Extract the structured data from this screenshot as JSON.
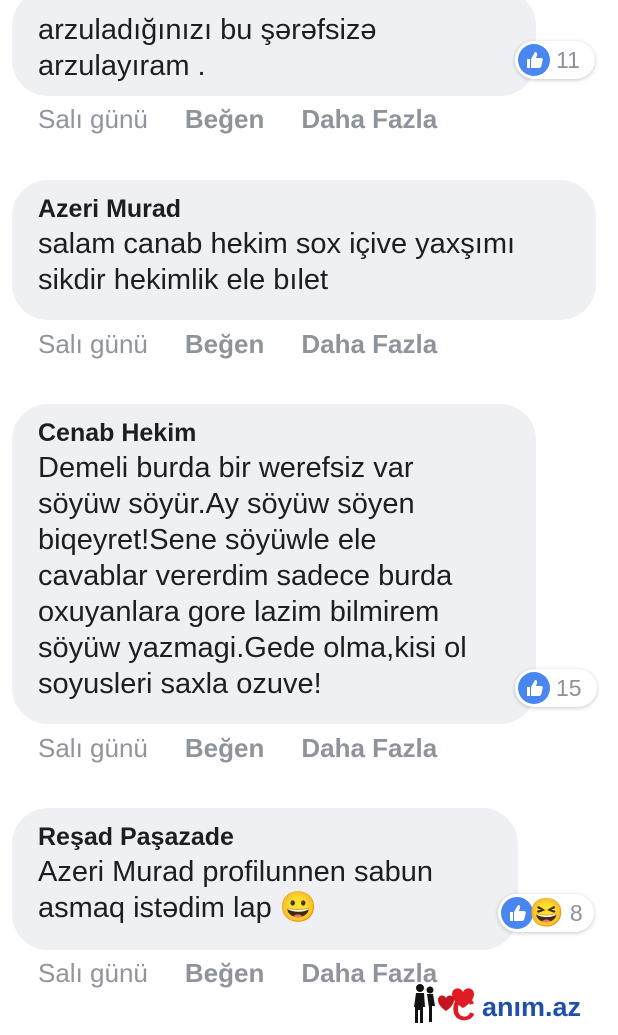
{
  "comments": [
    {
      "author": "",
      "text": "arzuladığınızı bu şərəfsizə\narzulayıram .",
      "time": "Salı günü",
      "like": "Beğen",
      "more": "Daha Fazla",
      "reaction_count": "11"
    },
    {
      "author": "Azeri Murad",
      "text": "salam canab hekim sox içive yaxşımı\nsikdir hekimlik ele bılet",
      "time": "Salı günü",
      "like": "Beğen",
      "more": "Daha Fazla",
      "reaction_count": ""
    },
    {
      "author": "Cenab Hekim",
      "text": "Demeli burda bir werefsiz var\nsöyüw söyür.Ay söyüw söyen\nbiqeyret!Sene söyüwle ele\ncavablar vererdim sadece burda\noxuyanlara gore lazim bilmirem\nsöyüw yazmagi.Gede olma,kisi ol\nsoyusleri saxla ozuve!",
      "time": "Salı günü",
      "like": "Beğen",
      "more": "Daha Fazla",
      "reaction_count": "15"
    },
    {
      "author": "Reşad Paşazade",
      "text": "Azeri Murad profilunnen sabun\nasmaq istədim lap",
      "text_emoji": "😀",
      "time": "Salı günü",
      "like": "Beğen",
      "more": "Daha Fazla",
      "reaction_count": "8",
      "reaction_emoji": "😆"
    }
  ],
  "watermark": {
    "text": "anım.az",
    "letter": "C"
  },
  "colors": {
    "like_blue": "#4a86f0",
    "bubble": "#eff0f3",
    "meta": "#90949c",
    "watermark_red": "#e01b24",
    "watermark_blue": "#1f4fa8"
  },
  "icons": {
    "like": "thumbs-up-icon",
    "haha": "laughing-emoji-icon",
    "smile": "grinning-emoji-icon"
  }
}
